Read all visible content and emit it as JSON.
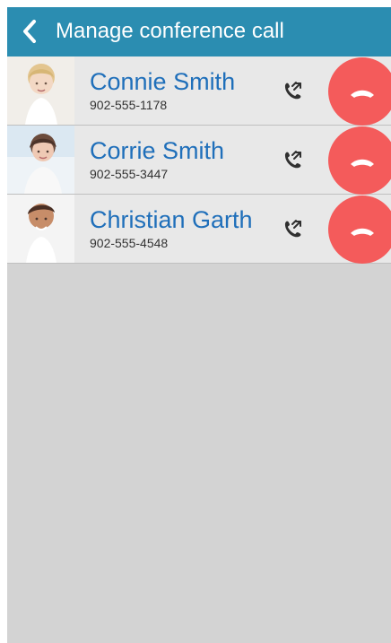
{
  "header": {
    "title": "Manage conference call",
    "back_icon": "chevron-left-icon"
  },
  "colors": {
    "header_bg": "#2b8db1",
    "name_text": "#1f6fba",
    "end_call": "#f45b5b",
    "background": "#d3d3d3"
  },
  "participants": [
    {
      "name": "Connie Smith",
      "phone": "902-555-1178",
      "actions": {
        "split_icon": "call-split-icon",
        "end_icon": "end-call-icon"
      }
    },
    {
      "name": "Corrie Smith",
      "phone": "902-555-3447",
      "actions": {
        "split_icon": "call-split-icon",
        "end_icon": "end-call-icon"
      }
    },
    {
      "name": "Christian Garth",
      "phone": "902-555-4548",
      "actions": {
        "split_icon": "call-split-icon",
        "end_icon": "end-call-icon"
      }
    }
  ]
}
